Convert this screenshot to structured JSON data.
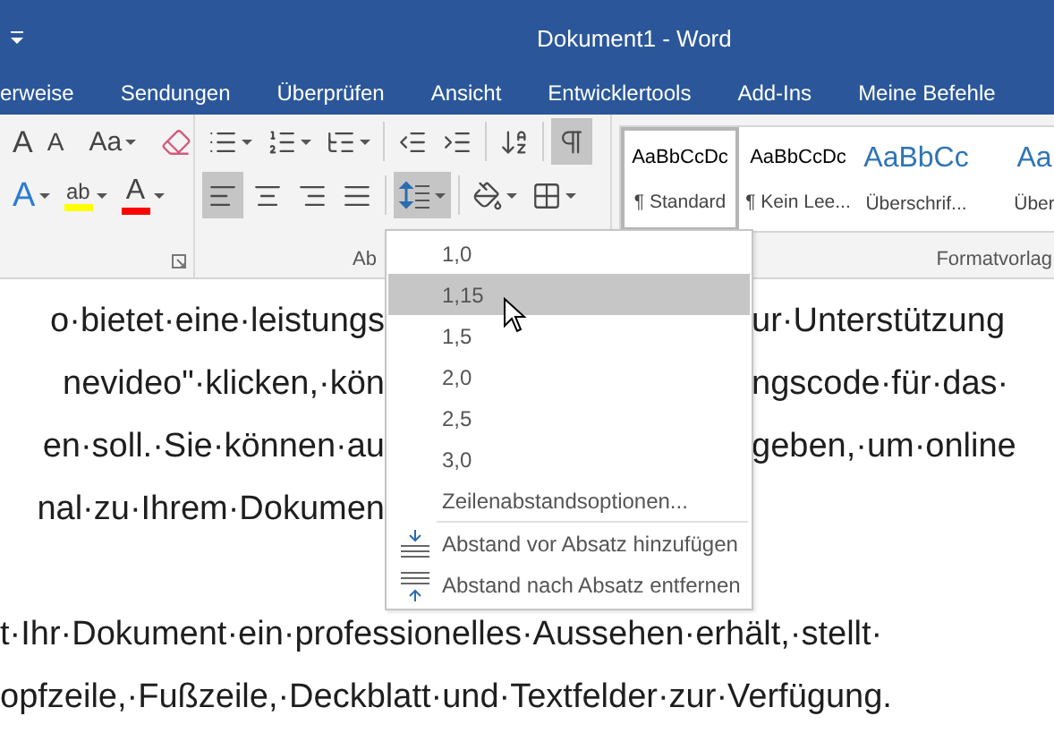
{
  "title_bar": {
    "title": "Dokument1 - Word"
  },
  "tabs": [
    {
      "label": "erweise",
      "selected": false
    },
    {
      "label": "Sendungen",
      "selected": false
    },
    {
      "label": "Überprüfen",
      "selected": false
    },
    {
      "label": "Ansicht",
      "selected": false
    },
    {
      "label": "Entwicklertools",
      "selected": false
    },
    {
      "label": "Add-Ins",
      "selected": false
    },
    {
      "label": "Meine Befehle",
      "selected": false
    }
  ],
  "ribbon": {
    "font_group": {
      "rows": [
        [
          {
            "kind": "grow",
            "glyph": "A",
            "pressed": false,
            "has_menu": false
          },
          {
            "kind": "shrink",
            "glyph": "A",
            "pressed": false,
            "has_menu": false
          },
          {
            "kind": "separator"
          },
          {
            "kind": "case",
            "glyph": "Aa",
            "pressed": false,
            "has_menu": true
          },
          {
            "kind": "separator"
          },
          {
            "kind": "clear",
            "pressed": false,
            "has_menu": false
          }
        ],
        [
          {
            "kind": "effects",
            "glyph": "A",
            "pressed": false,
            "has_menu": true
          },
          {
            "kind": "highlight",
            "glyph": "ab",
            "pressed": false,
            "has_menu": true
          },
          {
            "kind": "color",
            "glyph": "A",
            "pressed": false,
            "has_menu": true
          }
        ]
      ]
    },
    "paragraph_group": {
      "label": "Ab",
      "rows": [
        [
          {
            "kind": "bullets",
            "pressed": false,
            "has_menu": true
          },
          {
            "kind": "numbering",
            "pressed": false,
            "has_menu": true
          },
          {
            "kind": "multilevel",
            "pressed": false,
            "has_menu": true
          },
          {
            "kind": "separator"
          },
          {
            "kind": "outdent",
            "pressed": false,
            "has_menu": false
          },
          {
            "kind": "indent",
            "pressed": false,
            "has_menu": false
          },
          {
            "kind": "separator"
          },
          {
            "kind": "sort",
            "pressed": false,
            "has_menu": false
          },
          {
            "kind": "separator"
          },
          {
            "kind": "marks",
            "pressed": true,
            "has_menu": false
          }
        ],
        [
          {
            "kind": "align_left",
            "pressed": true,
            "has_menu": false
          },
          {
            "kind": "align_center",
            "pressed": false,
            "has_menu": false
          },
          {
            "kind": "align_right",
            "pressed": false,
            "has_menu": false
          },
          {
            "kind": "justify",
            "pressed": false,
            "has_menu": false
          },
          {
            "kind": "separator"
          },
          {
            "kind": "line_spacing",
            "pressed": true,
            "has_menu": true
          },
          {
            "kind": "separator"
          },
          {
            "kind": "shading",
            "pressed": false,
            "has_menu": true
          },
          {
            "kind": "borders",
            "pressed": false,
            "has_menu": true
          }
        ]
      ]
    },
    "styles_group": {
      "label": "Formatvorlag",
      "styles": [
        {
          "preview": "AaBbCcDc",
          "name": "¶ Standard",
          "kind": "normal",
          "selected": true
        },
        {
          "preview": "AaBbCcDc",
          "name": "¶ Kein Lee...",
          "kind": "normal",
          "selected": false
        },
        {
          "preview": "AaBbCc",
          "name": "Überschrif...",
          "kind": "heading",
          "selected": false
        },
        {
          "preview": "Aa",
          "name": "Über",
          "kind": "heading2",
          "selected": false
        }
      ]
    }
  },
  "document": {
    "paragraphs": [
      {
        "lines": [
          {
            "left": "o·bietet·eine·leistungs",
            "right": "ur·Unterstützung"
          },
          {
            "left": "nevideo\"·klicken,·kön",
            "right": "ngscode·für·das·"
          },
          {
            "left": "en·soll.·Sie·können·au",
            "right": "geben,·um·online"
          },
          {
            "left": "nal·zu·Ihrem·Dokumen"
          }
        ]
      },
      {
        "lines": [
          {
            "text": "t·Ihr·Dokument·ein·professionelles·Aussehen·erhält,·stellt·"
          },
          {
            "text": "opfzeile,·Fußzeile,·Deckblatt·und·Textfelder·zur·Verfügung."
          }
        ]
      }
    ]
  },
  "line_spacing_menu": {
    "items": [
      {
        "kind": "value",
        "label": "1,0",
        "selected": false
      },
      {
        "kind": "value",
        "label": "1,15",
        "selected": true
      },
      {
        "kind": "value",
        "label": "1,5",
        "selected": false
      },
      {
        "kind": "value",
        "label": "2,0",
        "selected": false
      },
      {
        "kind": "value",
        "label": "2,5",
        "selected": false
      },
      {
        "kind": "value",
        "label": "3,0",
        "selected": false
      },
      {
        "kind": "options",
        "label": "Zeilenabstandsoptionen...",
        "selected": false
      },
      {
        "kind": "add_before",
        "label": "Abstand vor Absatz hinzufügen",
        "selected": false
      },
      {
        "kind": "remove_after",
        "label": "Abstand nach Absatz entfernen",
        "selected": false
      }
    ]
  }
}
